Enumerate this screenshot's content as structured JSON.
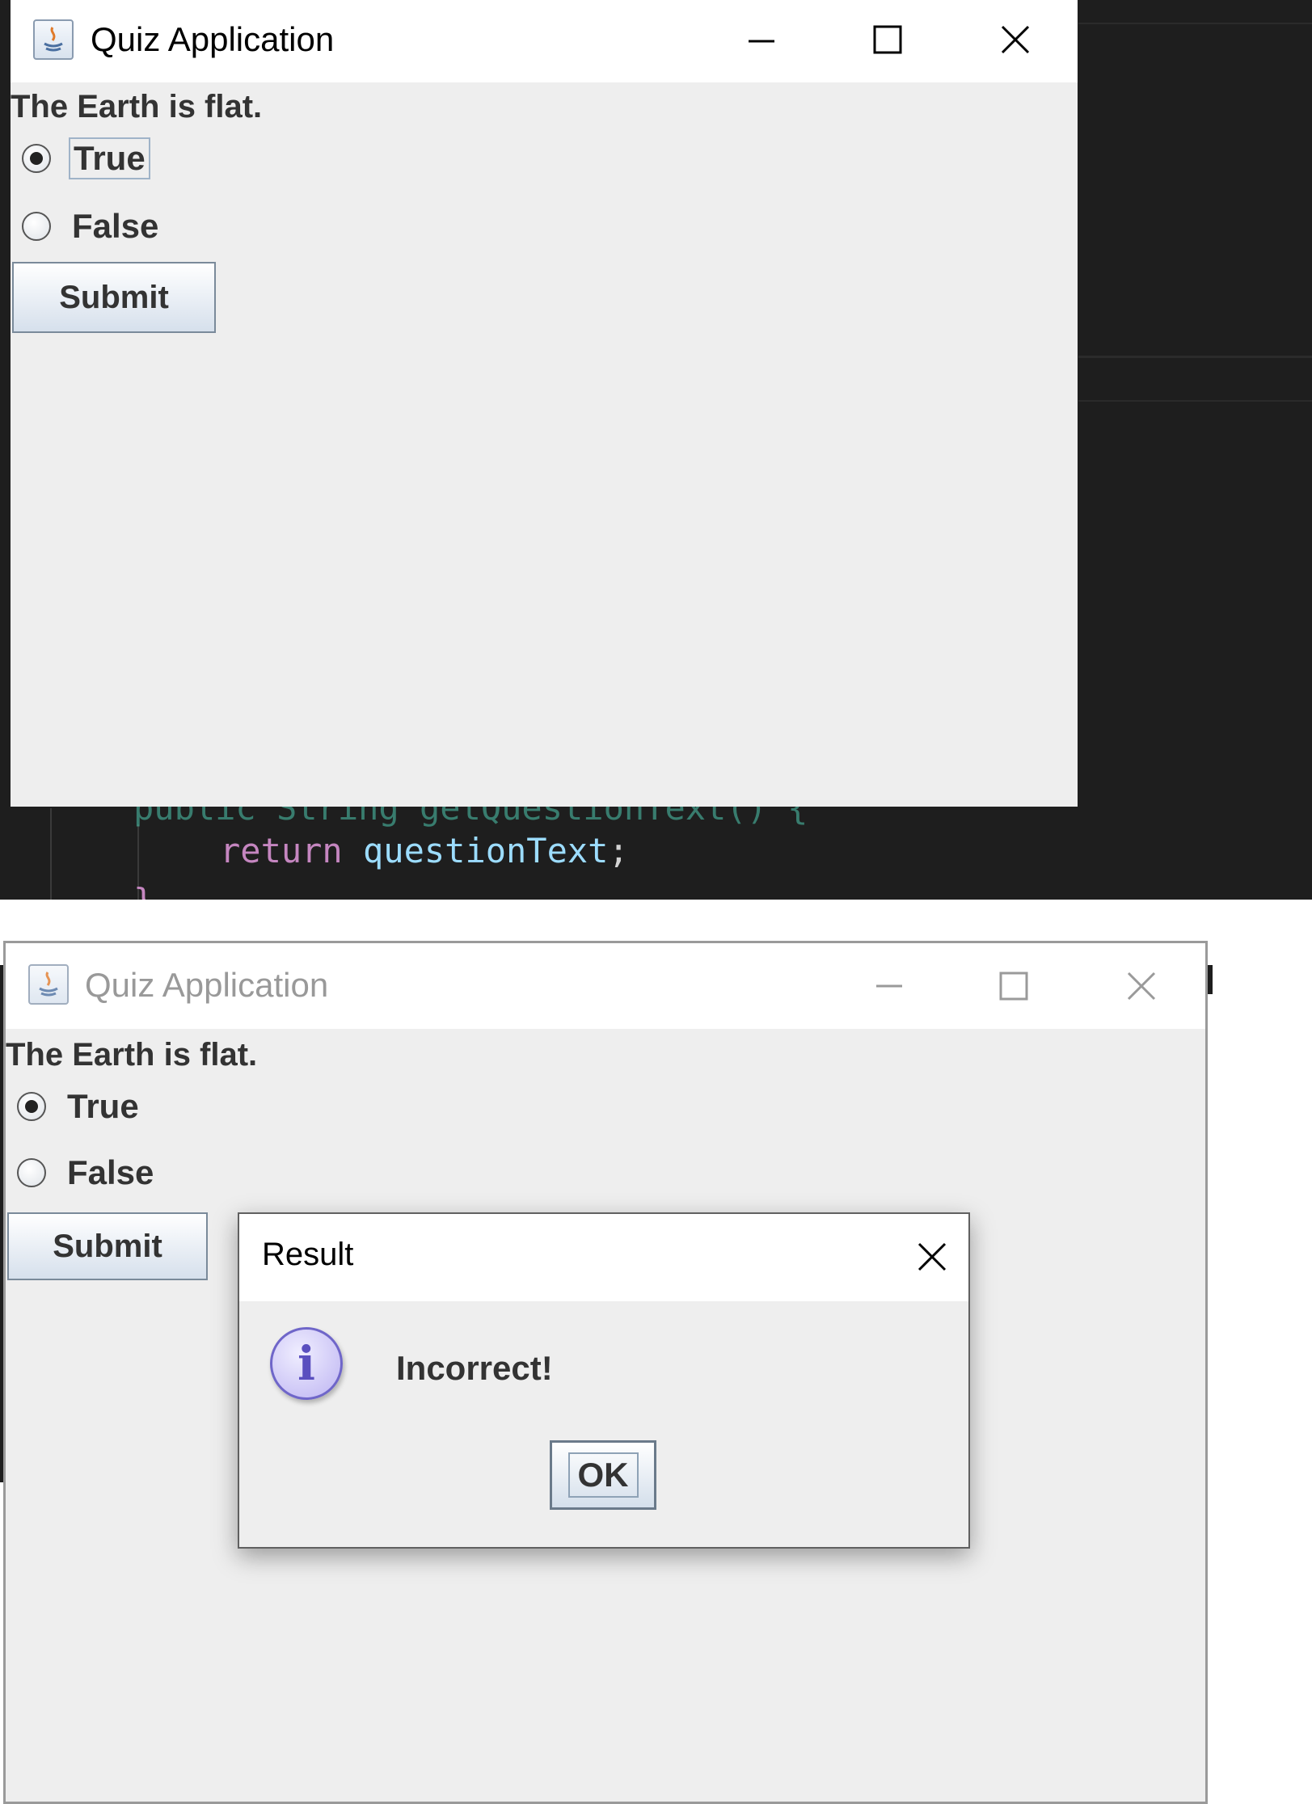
{
  "top_shot": {
    "window": {
      "title": "Quiz Application",
      "question": "The Earth is flat.",
      "options": [
        {
          "label": "True",
          "selected": true
        },
        {
          "label": "False",
          "selected": false
        }
      ],
      "submit_label": "Submit",
      "controls": [
        "minimize-icon",
        "maximize-icon",
        "close-icon"
      ]
    },
    "code_editor": {
      "line_keyword": "return",
      "line_identifier": "questionText",
      "line_punct": ";"
    }
  },
  "bottom_shot": {
    "window": {
      "title": "Quiz Application",
      "question": "The Earth is flat.",
      "options": [
        {
          "label": "True",
          "selected": true
        },
        {
          "label": "False",
          "selected": false
        }
      ],
      "submit_label": "Submit"
    },
    "dialog": {
      "title": "Result",
      "icon": "info-icon",
      "icon_glyph": "i",
      "message": "Incorrect!",
      "ok_label": "OK"
    }
  },
  "colors": {
    "window_bg": "#eeeeee",
    "titlebar_bg": "#ffffff",
    "editor_bg": "#1e1e1e",
    "code_keyword": "#c586c0",
    "code_identifier": "#9cdcfe",
    "info_icon": "#6f66c9"
  }
}
